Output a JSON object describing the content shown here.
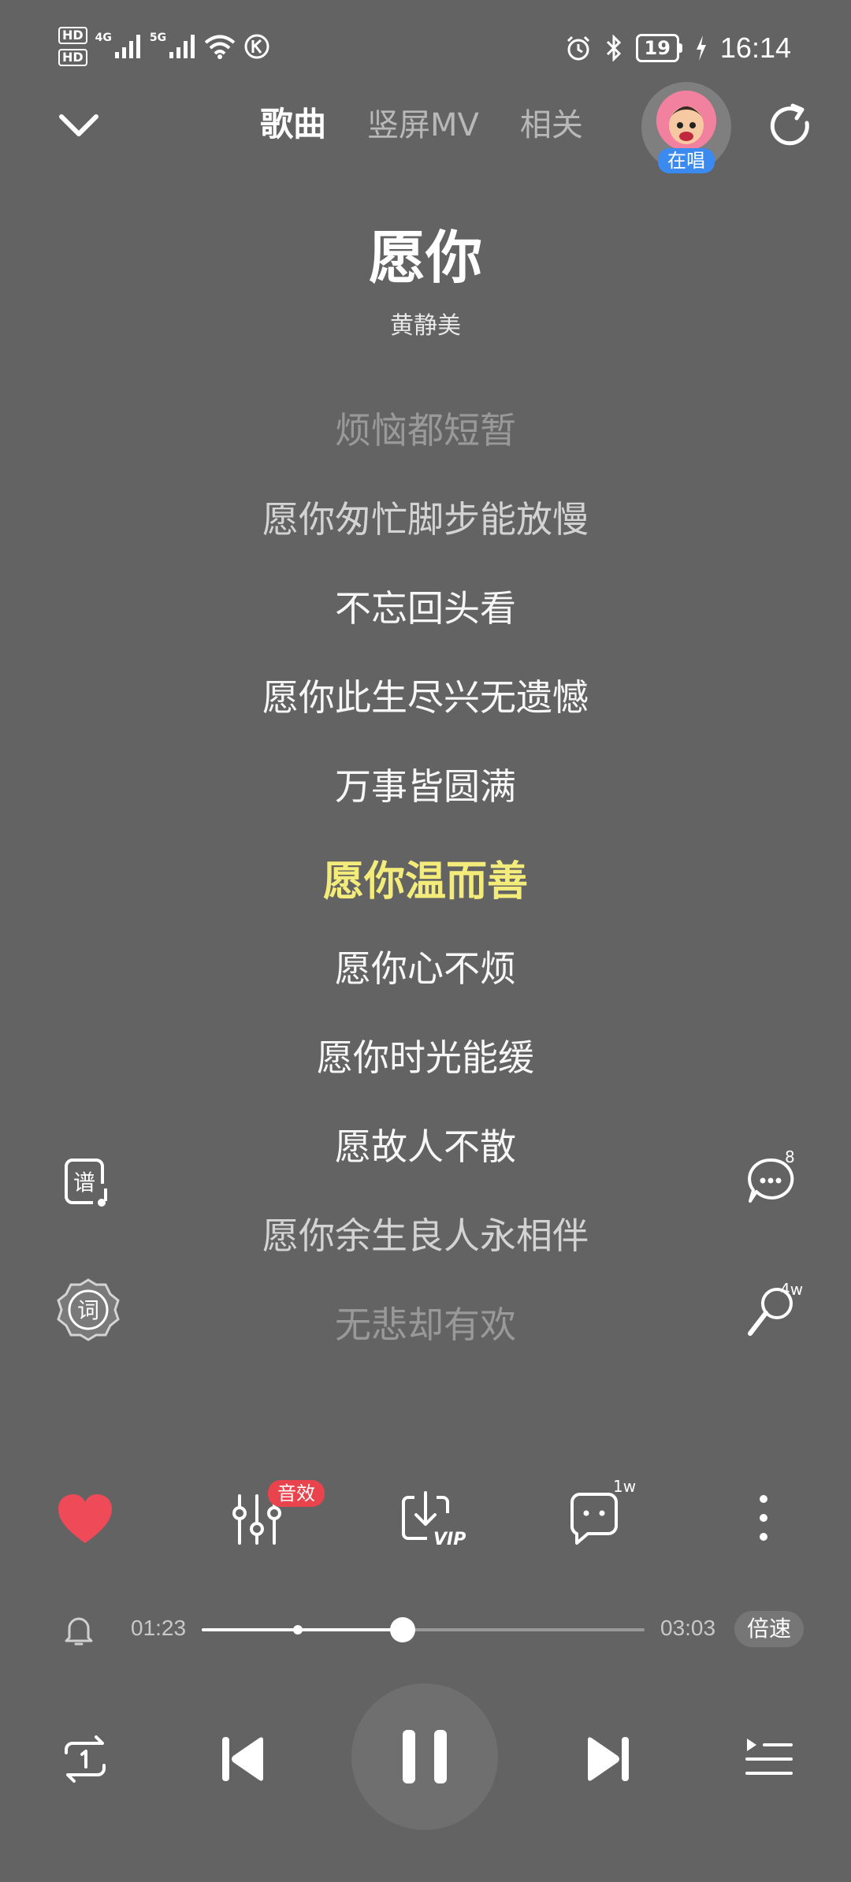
{
  "status_bar": {
    "hd1": "HD",
    "hd2": "HD",
    "net1": "4G",
    "net2": "5G",
    "battery": "19",
    "time": "16:14"
  },
  "header": {
    "tabs": [
      {
        "label": "歌曲",
        "active": true
      },
      {
        "label": "竖屏MV",
        "active": false
      },
      {
        "label": "相关",
        "active": false
      }
    ],
    "singing_label": "在唱"
  },
  "song": {
    "title": "愿你",
    "artist": "黄静美"
  },
  "lyrics": [
    {
      "text": "烦恼都短暂"
    },
    {
      "text": "愿你匆忙脚步能放慢"
    },
    {
      "text": "不忘回头看"
    },
    {
      "text": "愿你此生尽兴无遗憾"
    },
    {
      "text": "万事皆圆满"
    },
    {
      "text": "愿你温而善",
      "current": true
    },
    {
      "text": "愿你心不烦"
    },
    {
      "text": "愿你时光能缓"
    },
    {
      "text": "愿故人不散"
    },
    {
      "text": "愿你余生良人永相伴"
    },
    {
      "text": "无悲却有欢"
    }
  ],
  "side": {
    "score_label": "谱",
    "lyric_label": "词",
    "comment_count": "8",
    "sing_count": "4w"
  },
  "actions": {
    "sfx_badge": "音效",
    "vip_label": "VIP",
    "comment_count": "1w"
  },
  "progress": {
    "current": "01:23",
    "total": "03:03",
    "fraction": 0.453,
    "buffer_fraction": 0.217,
    "speed_label": "倍速"
  },
  "colors": {
    "background": "#636363",
    "current_lyric": "#f4ec7a",
    "like": "#ef4a57",
    "badge": "#e9444d",
    "singing_badge": "#3b8af0"
  }
}
